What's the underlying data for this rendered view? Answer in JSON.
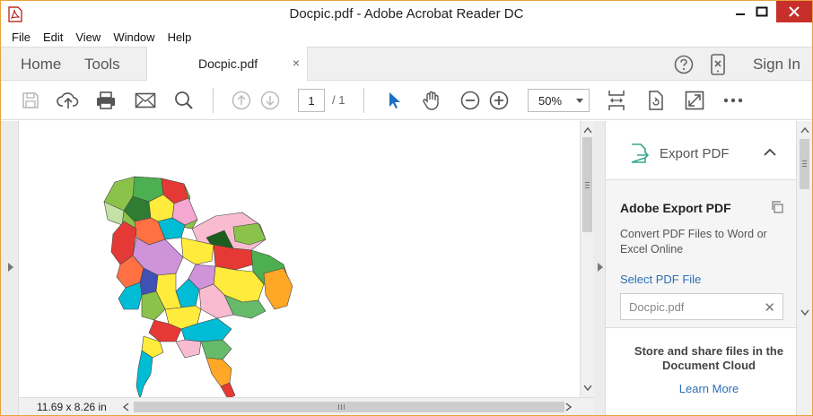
{
  "window": {
    "title": "Docpic.pdf - Adobe Acrobat Reader DC",
    "accent_color": "#e8a23d",
    "close_color": "#c7302a"
  },
  "menu": [
    "File",
    "Edit",
    "View",
    "Window",
    "Help"
  ],
  "tabs": {
    "home": "Home",
    "tools": "Tools",
    "document": "Docpic.pdf",
    "close_glyph": "×",
    "sign_in": "Sign In"
  },
  "toolbar": {
    "page_current": "1",
    "page_total": "/ 1",
    "zoom": "50%",
    "icons": [
      "save-icon",
      "upload-icon",
      "print-icon",
      "email-icon",
      "search-icon",
      "prev-page-icon",
      "next-page-icon",
      "select-cursor-icon",
      "hand-tool-icon",
      "zoom-out-icon",
      "zoom-in-icon",
      "fit-page-icon",
      "rotate-icon",
      "fullscreen-icon",
      "more-icon"
    ]
  },
  "document": {
    "page_size": "11.69 x 8.26 in"
  },
  "right_pane": {
    "export_title": "Export PDF",
    "heading": "Adobe Export PDF",
    "description": "Convert PDF Files to Word or Excel Online",
    "select_link": "Select PDF File",
    "file_name": "Docpic.pdf",
    "clear_glyph": "✕",
    "cloud_text": "Store and share files in the Document Cloud",
    "learn_more": "Learn More",
    "link_color": "#2a6fb6",
    "export_icon_color": "#3aa88f"
  }
}
